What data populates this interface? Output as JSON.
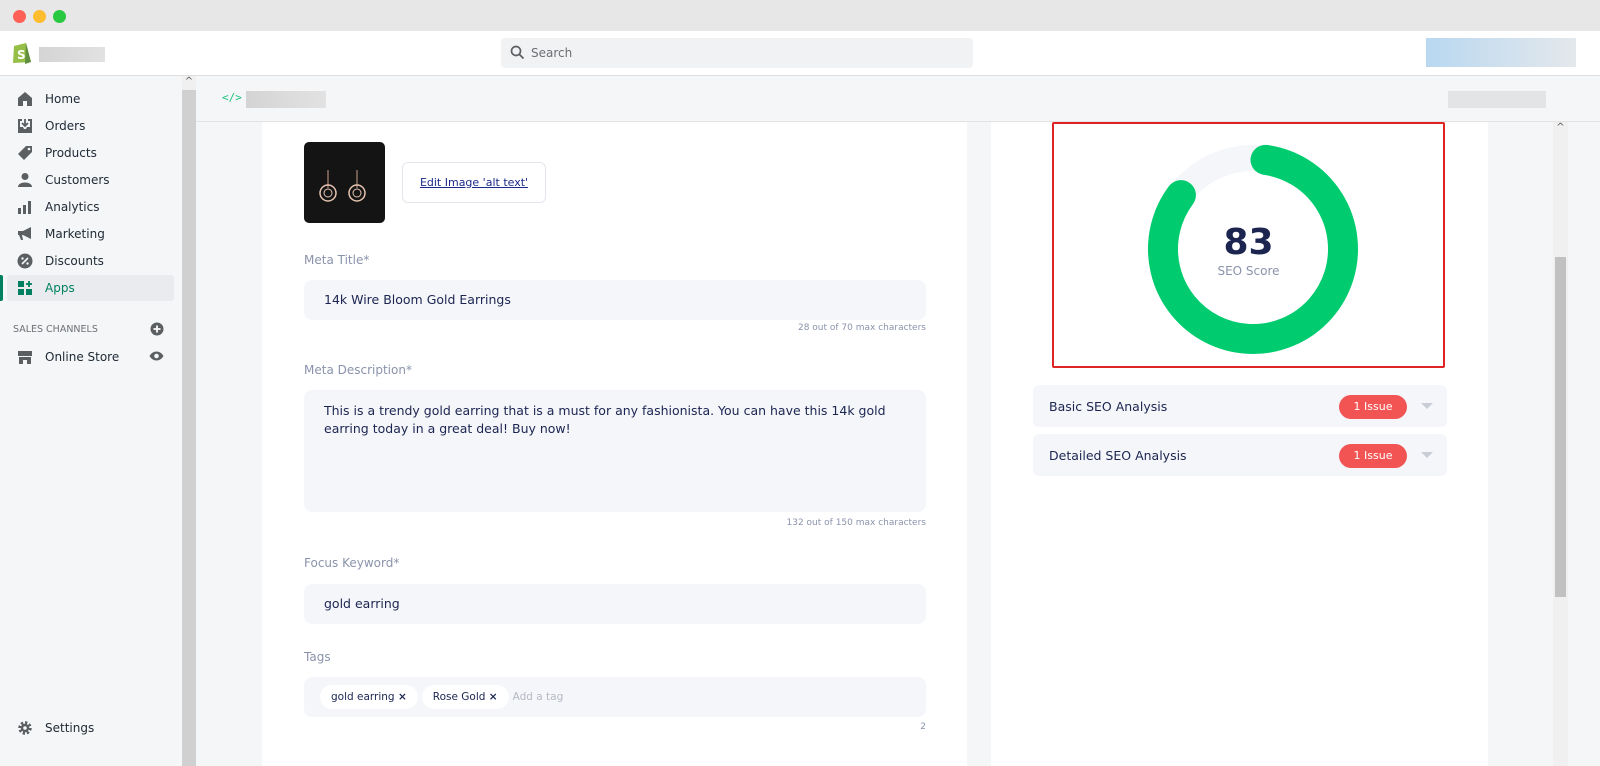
{
  "window": {
    "controls": [
      "close",
      "minimize",
      "maximize"
    ],
    "colors": {
      "close": "#fe5f57",
      "minimize": "#febc2e",
      "maximize": "#28c840"
    }
  },
  "header": {
    "search_placeholder": "Search"
  },
  "sidebar": {
    "items": [
      {
        "label": "Home",
        "icon": "home-icon"
      },
      {
        "label": "Orders",
        "icon": "orders-icon"
      },
      {
        "label": "Products",
        "icon": "tag-icon"
      },
      {
        "label": "Customers",
        "icon": "person-icon"
      },
      {
        "label": "Analytics",
        "icon": "bar-chart-icon"
      },
      {
        "label": "Marketing",
        "icon": "megaphone-icon"
      },
      {
        "label": "Discounts",
        "icon": "discount-icon"
      },
      {
        "label": "Apps",
        "icon": "apps-icon",
        "active": true
      }
    ],
    "sales_channels_label": "SALES CHANNELS",
    "online_store": "Online Store",
    "settings": "Settings"
  },
  "form": {
    "image_button": "Edit Image 'alt text'",
    "meta_title_label": "Meta Title*",
    "meta_title_value": "14k Wire Bloom Gold Earrings",
    "meta_title_hint": "28 out of 70 max characters",
    "meta_desc_label": "Meta Description*",
    "meta_desc_value": "This is a trendy gold earring that is a must for any fashionista. You can have this 14k gold earring today in a great deal! Buy now!",
    "meta_desc_hint": "132 out of 150 max characters",
    "focus_label": "Focus Keyword*",
    "focus_value": "gold earring",
    "tags_label": "Tags",
    "tags": [
      "gold earring",
      "Rose Gold"
    ],
    "tag_remove": "×",
    "tags_placeholder": "Add a tag",
    "tags_count": "2"
  },
  "seo": {
    "score": "83",
    "score_value": 83,
    "score_label": "SEO Score",
    "accent": "#00cc6f",
    "highlight_color": "#e02424",
    "sections": [
      {
        "title": "Basic SEO Analysis",
        "badge": "1 Issue"
      },
      {
        "title": "Detailed SEO Analysis",
        "badge": "1 Issue"
      }
    ]
  }
}
